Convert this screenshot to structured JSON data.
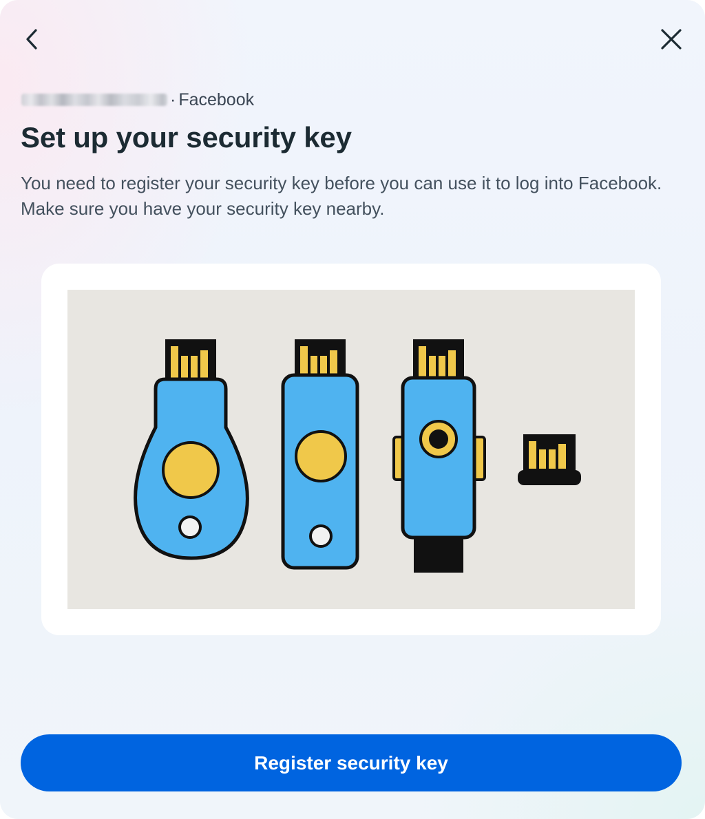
{
  "header": {
    "back_icon": "chevron-left-icon",
    "close_icon": "close-icon"
  },
  "account": {
    "separator": "·",
    "app_name": "Facebook"
  },
  "title": "Set up your security key",
  "description": "You need to register your security key before you can use it to log into Facebook. Make sure you have your security key nearby.",
  "illustration": {
    "items": [
      "security-key-teardrop",
      "security-key-rectangular",
      "security-key-with-cap",
      "security-key-nano"
    ],
    "colors": {
      "background": "#e8e6e1",
      "key_body": "#4fb3f0",
      "gold": "#f0c84a",
      "outline": "#111111"
    }
  },
  "actions": {
    "register_label": "Register security key"
  },
  "colors": {
    "primary_button": "#0064e0",
    "title_text": "#1c2b33",
    "body_text": "#44515e"
  }
}
